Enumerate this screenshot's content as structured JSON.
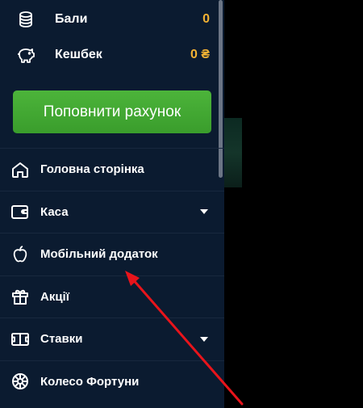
{
  "balances": [
    {
      "label": "Бали",
      "value": "0",
      "icon": "coins-icon"
    },
    {
      "label": "Кешбек",
      "value": "0 ₴",
      "icon": "piggy-bank-icon"
    }
  ],
  "topup_button": {
    "label": "Поповнити рахунок",
    "color": "#43a934"
  },
  "menu": [
    {
      "label": "Головна сторінка",
      "icon": "home-icon",
      "has_dropdown": false
    },
    {
      "label": "Каса",
      "icon": "wallet-icon",
      "has_dropdown": true
    },
    {
      "label": "Мобільний додаток",
      "icon": "apple-icon",
      "has_dropdown": false
    },
    {
      "label": "Акції",
      "icon": "gift-icon",
      "has_dropdown": false
    },
    {
      "label": "Ставки",
      "icon": "ticket-icon",
      "has_dropdown": true
    },
    {
      "label": "Колесо Фортуни",
      "icon": "wheel-icon",
      "has_dropdown": false
    }
  ],
  "colors": {
    "drawer_bg": "#0b1b30",
    "accent_value": "#f2b233",
    "annotation_arrow": "#e8141b"
  }
}
